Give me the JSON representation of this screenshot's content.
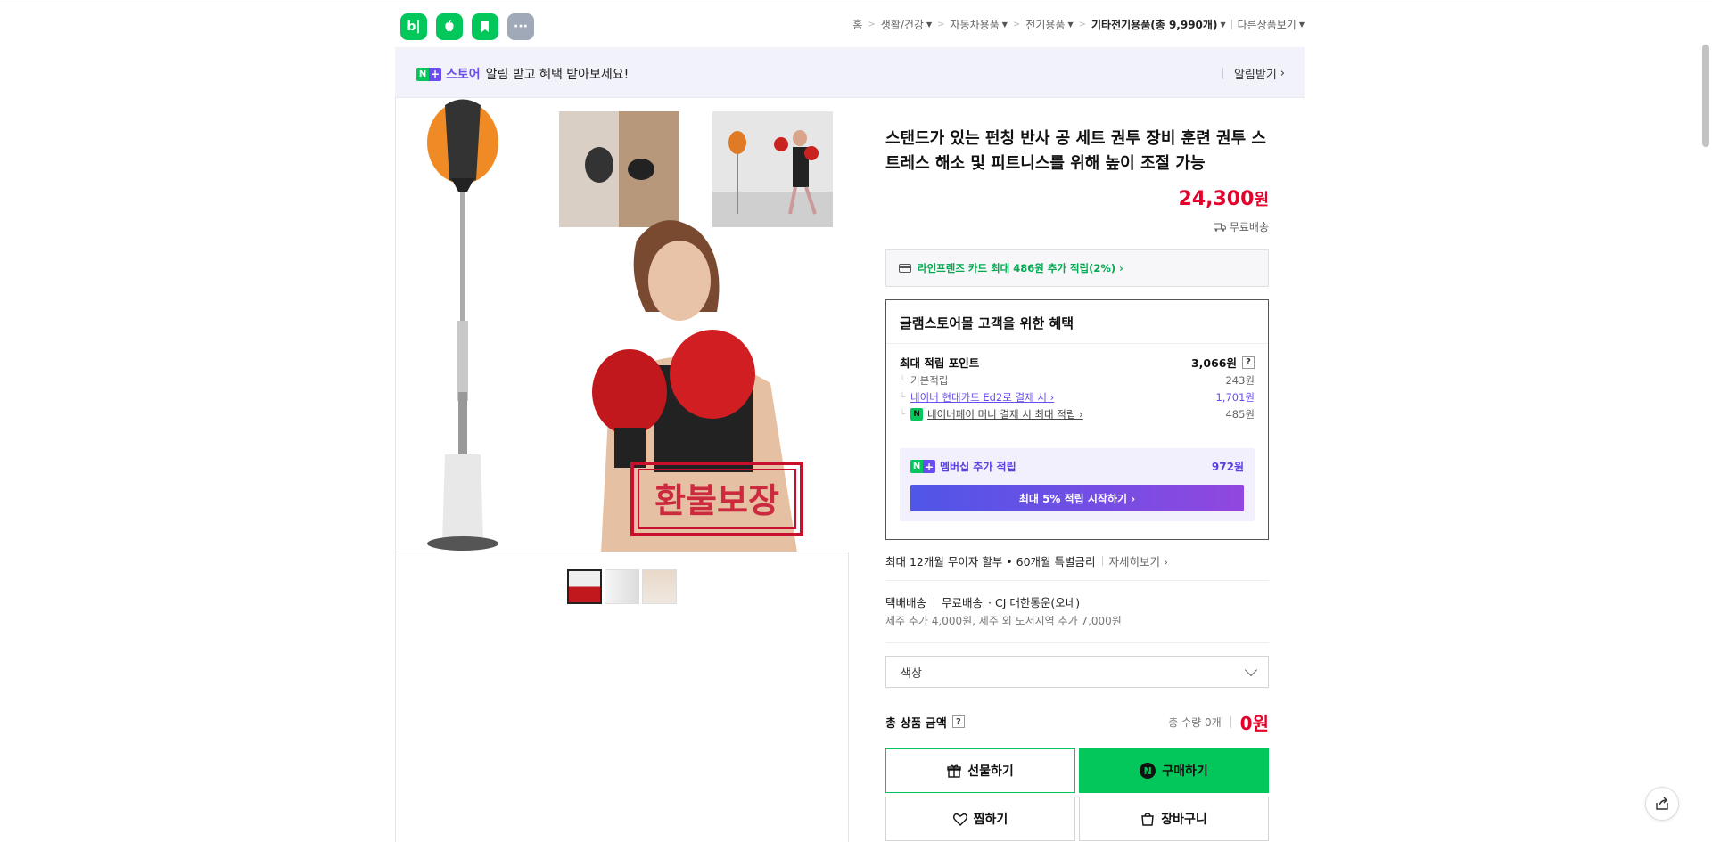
{
  "header": {
    "icons": [
      "blog-icon",
      "apple-icon",
      "bookmark-icon",
      "more-icon"
    ],
    "blog_label": "b|",
    "more_label": "···",
    "breadcrumbs": [
      {
        "label": "홈",
        "has_caret": false
      },
      {
        "label": "생활/건강",
        "has_caret": true
      },
      {
        "label": "자동차용품",
        "has_caret": true
      },
      {
        "label": "전기용품",
        "has_caret": true
      },
      {
        "label": "기타전기용품(총 9,990개)",
        "has_caret": true
      }
    ],
    "other_products": "다른상품보기"
  },
  "banner": {
    "store_label": "스토어",
    "message": "알림 받고 혜택 받아보세요!",
    "notify_label": "알림받기",
    "n_label": "N",
    "plus_label": "+"
  },
  "product": {
    "title": "스탠드가 있는 펀칭 반사 공 세트 권투 장비 훈련 권투 스트레스 해소 및 피트니스를 위해 높이 조절 가능",
    "price": "24,300",
    "price_unit": "원",
    "shipping_badge": "무료배송",
    "image_watermark": "환불보장",
    "thumbnail_count": 3
  },
  "card_promo": "라인프렌즈 카드 최대 486원 추가 적립(2%) ›",
  "benefit": {
    "title": "글램스토어몰 고객을 위한 혜택",
    "max_points_label": "최대 적립 포인트",
    "max_points_value": "3,066원",
    "help_label": "?",
    "rows": [
      {
        "label": "기본적립",
        "value": "243원"
      },
      {
        "label": "네이버 현대카드 Ed2로 결제 시 ›",
        "value": "1,701원"
      },
      {
        "label": "네이버페이 머니 결제 시 최대 적립 ›",
        "value": "485원"
      }
    ],
    "npay_icon_label": "N",
    "membership_label": "멤버십 추가 적립",
    "membership_value": "972원",
    "membership_button": "최대 5% 적립 시작하기 ›"
  },
  "installment": {
    "text": "최대 12개월 무이자 할부 • 60개월 특별금리",
    "more": "자세히보기 ›"
  },
  "delivery": {
    "type": "택배배송",
    "fee": "무료배송",
    "carrier": "· CJ 대한통운(오네)",
    "extra": "제주 추가 4,000원, 제주 외 도서지역 추가 7,000원"
  },
  "option_select": {
    "label": "색상"
  },
  "total": {
    "label": "총 상품 금액",
    "qty": "총 수량 0개",
    "amount": "0원"
  },
  "buttons": {
    "gift": "선물하기",
    "buy": "구매하기",
    "buy_badge": "N",
    "wish": "찜하기",
    "cart": "장바구니"
  },
  "colors": {
    "naver_green": "#03c75a",
    "price_red": "#e4022d",
    "store_purple": "#6a4cf0"
  }
}
